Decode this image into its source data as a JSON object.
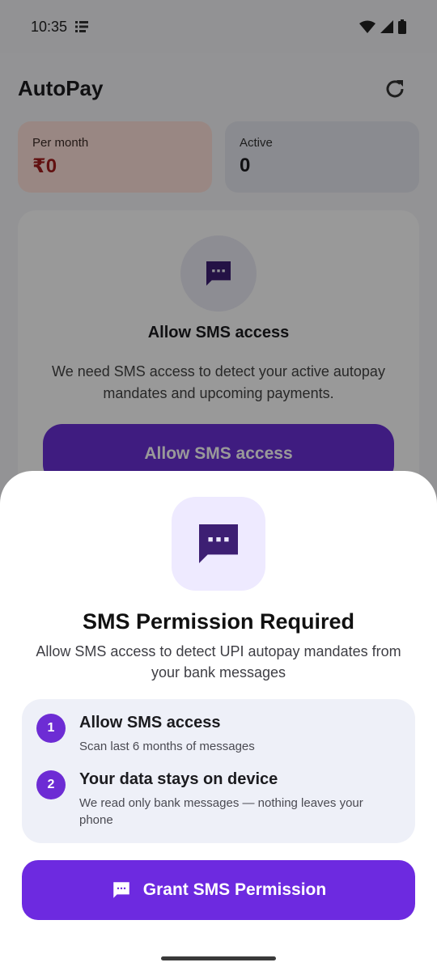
{
  "status_bar": {
    "time": "10:35"
  },
  "app": {
    "title": "AutoPay",
    "stats": [
      {
        "label": "Per month",
        "value": "₹0"
      },
      {
        "label": "Active",
        "value": "0"
      }
    ],
    "prompt": {
      "title": "Allow SMS access",
      "description": "We need SMS access to detect your active autopay mandates and upcoming payments.",
      "button_label": "Allow SMS access"
    }
  },
  "sheet": {
    "title": "SMS Permission Required",
    "description": "Allow SMS access to detect UPI autopay mandates from your bank messages",
    "steps": [
      {
        "number": "1",
        "title": "Allow SMS access",
        "description": "Scan last 6 months of messages"
      },
      {
        "number": "2",
        "title": "Your data stays on device",
        "description": "We read only bank messages — nothing leaves your phone"
      }
    ],
    "button_label": "Grant SMS Permission"
  },
  "colors": {
    "accent": "#6d2ae0",
    "icon_dark": "#3d1f73",
    "per_month_value": "#a31d1d"
  },
  "icons": [
    "note-icon",
    "wifi-icon",
    "signal-icon",
    "battery-icon",
    "refresh-icon",
    "sms-icon"
  ]
}
